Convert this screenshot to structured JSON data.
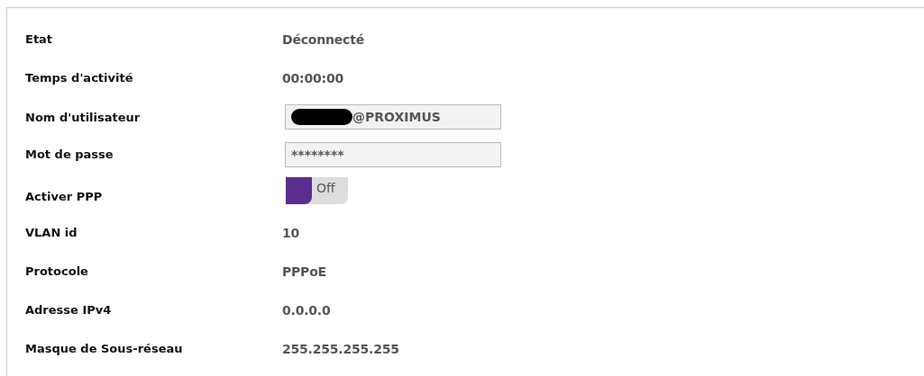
{
  "rows": [
    {
      "kind": "text",
      "label": "Etat",
      "value": "Déconnecté"
    },
    {
      "kind": "text",
      "label": "Temps d'activité",
      "value": "00:00:00"
    },
    {
      "kind": "field",
      "label": "Nom d'utilisateur",
      "value": "@PROXIMUS",
      "redacted": true
    },
    {
      "kind": "field",
      "label": "Mot de passe",
      "value": "********",
      "redacted": false
    },
    {
      "kind": "toggle",
      "label": "Activer PPP",
      "on": false,
      "state_label": "Off"
    },
    {
      "kind": "text",
      "label": "VLAN id",
      "value": "10"
    },
    {
      "kind": "text",
      "label": "Protocole",
      "value": "PPPoE"
    },
    {
      "kind": "text",
      "label": "Adresse IPv4",
      "value": "0.0.0.0"
    },
    {
      "kind": "text",
      "label": "Masque de Sous-réseau",
      "value": "255.255.255.255"
    }
  ]
}
